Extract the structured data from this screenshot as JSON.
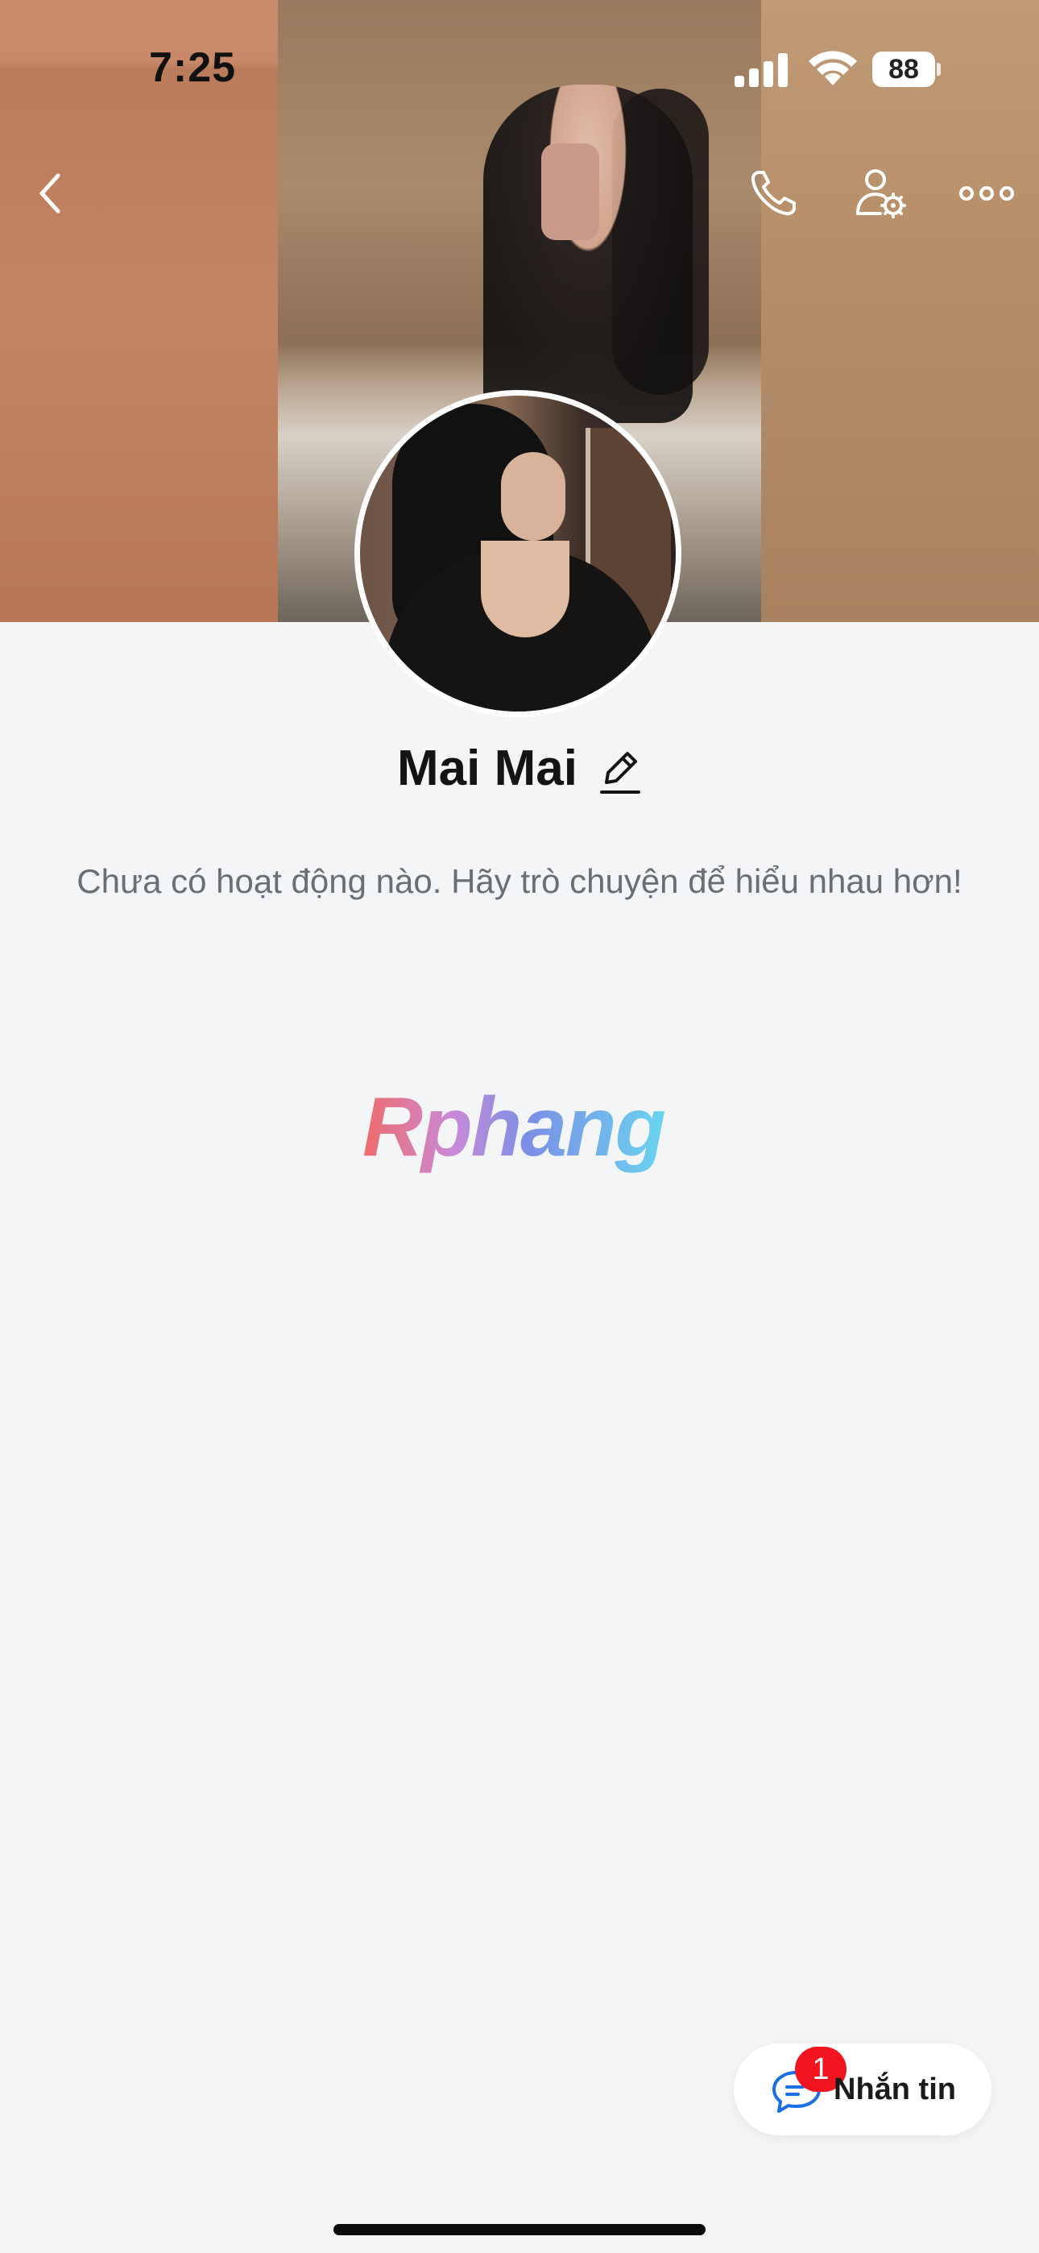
{
  "status_bar": {
    "time": "7:25",
    "battery": "88"
  },
  "nav": {
    "back_icon": "chevron-left-icon",
    "call_icon": "phone-icon",
    "profile_settings_icon": "user-gear-icon",
    "more_icon": "more-horizontal-icon"
  },
  "profile": {
    "name": "Mai Mai",
    "activity_text": "Chưa có hoạt động nào. Hãy trò chuyện để hiểu nhau hơn!"
  },
  "watermark": "Rphang",
  "message_button": {
    "label": "Nhắn tin",
    "badge": "1"
  },
  "colors": {
    "background": "#f4f5f7",
    "accent_blue": "#1a6fe8",
    "badge_red": "#f2141f",
    "text_dark": "#141414",
    "text_secondary": "#6b6e73"
  }
}
